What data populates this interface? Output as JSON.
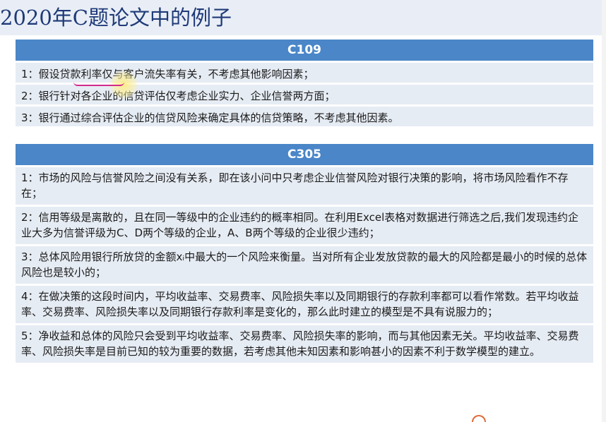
{
  "page_title": "2020年C题论文中的例子",
  "sections": [
    {
      "header": "C109",
      "items": [
        "1：假设贷款利率仅与客户流失率有关，不考虑其他影响因素；",
        "2：银行针对各企业的信贷评估仅考虑企业实力、企业信誉两方面；",
        "3：银行通过综合评估企业的信贷风险来确定具体的信贷策略，不考虑其他因素。"
      ]
    },
    {
      "header": "C305",
      "items": [
        "1：市场的风险与信誉风险之间没有关系，即在该小问中只考虑企业信誉风险对银行决策的影响，将市场风险看作不存在；",
        "2：信用等级是离散的，且在同一等级中的企业违约的概率相同。在利用Excel表格对数据进行筛选之后,我们发现违约企业大多为信誉评级为C、D两个等级的企业，A、B两个等级的企业很少违约；",
        "3：总体风险用银行所放贷的金额xᵢ中最大的一个风险来衡量。当对所有企业发放贷款的最大的风险都是最小的时候的总体风险也是较小的；",
        "4：在做决策的这段时间内，平均收益率、交易费率、风险损失率以及同期银行的存款利率都可以看作常数。若平均收益率、交易费率、风险损失率以及同期银行存款利率是变化的，那么此时建立的模型是不具有说服力的；",
        "5：净收益和总体的风险只会受到平均收益率、交易费率、风险损失率的影响，而与其他因素无关。平均收益率、交易费率、风险损失率是目前已知的较为重要的数据，若考虑其他未知因素和影响甚小的因素不利于数学模型的建立。"
      ]
    }
  ]
}
